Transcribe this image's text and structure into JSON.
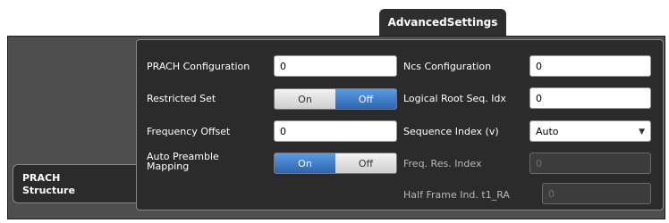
{
  "top_tab": {
    "label": "AdvancedSettings"
  },
  "left_tab": {
    "line1": "PRACH",
    "line2": "Structure"
  },
  "fields": {
    "prach_configuration": {
      "label": "PRACH Configuration",
      "value": "0"
    },
    "restricted_set": {
      "label": "Restricted Set",
      "on": "On",
      "off": "Off",
      "selected": "Off"
    },
    "frequency_offset": {
      "label": "Frequency Offset",
      "value": "0"
    },
    "auto_preamble_mapping": {
      "label_line1": "Auto Preamble",
      "label_line2": "Mapping",
      "on": "On",
      "off": "Off",
      "selected": "On"
    },
    "ncs_configuration": {
      "label": "Ncs Configuration",
      "value": "0"
    },
    "logical_root_seq_idx": {
      "label": "Logical Root Seq. Idx",
      "value": "0"
    },
    "sequence_index": {
      "label": "Sequence Index (v)",
      "value": "Auto",
      "icon": "chevron-down-icon"
    },
    "freq_res_index": {
      "label": "Freq. Res. Index",
      "value": "0"
    },
    "half_frame_ind": {
      "label": "Half Frame Ind. t1_RA",
      "value": "0"
    }
  }
}
